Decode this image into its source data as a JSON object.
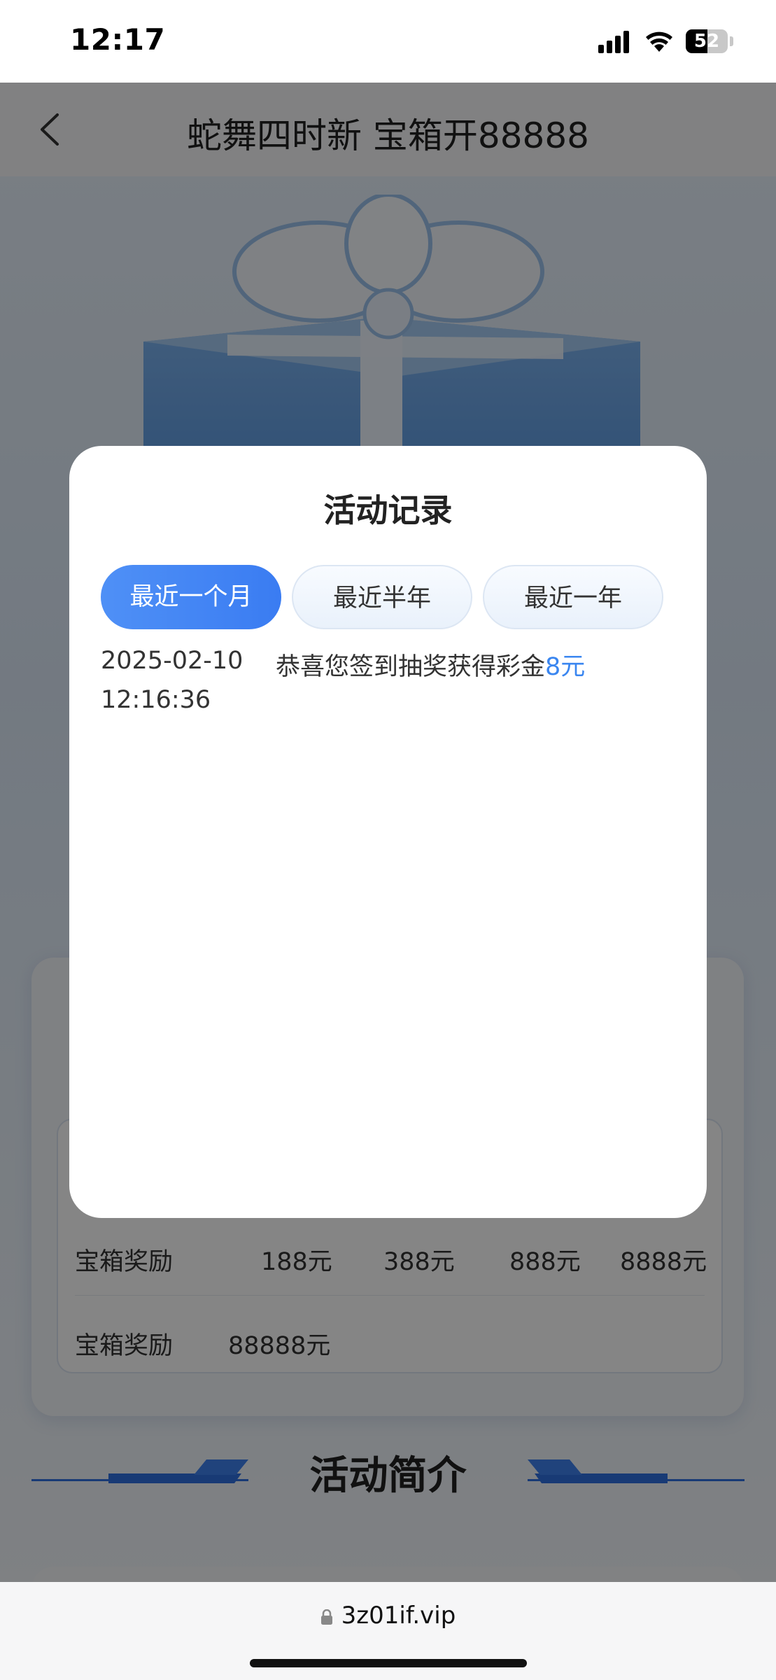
{
  "status_bar": {
    "time": "12:17",
    "battery": "52"
  },
  "nav": {
    "title": "蛇舞四时新 宝箱开88888"
  },
  "reward_table": {
    "rows": [
      {
        "label": "宝箱奖励",
        "values": [
          "188元",
          "388元",
          "888元",
          "8888元"
        ]
      },
      {
        "label": "宝箱奖励",
        "values": [
          "88888元"
        ]
      }
    ]
  },
  "intro": {
    "title": "活动简介"
  },
  "modal": {
    "title": "活动记录",
    "tabs": [
      {
        "label": "最近一个月",
        "active": true
      },
      {
        "label": "最近半年",
        "active": false
      },
      {
        "label": "最近一年",
        "active": false
      }
    ],
    "records": [
      {
        "date": "2025-02-10",
        "time": "12:16:36",
        "text": "恭喜您签到抽奖获得彩金",
        "amount": "8元"
      }
    ]
  },
  "browser": {
    "url": "3z01if.vip"
  },
  "colors": {
    "accent": "#3a86f0",
    "tab_active": "#4f90f6",
    "overlay": "rgba(0,0,0,0.48)"
  }
}
